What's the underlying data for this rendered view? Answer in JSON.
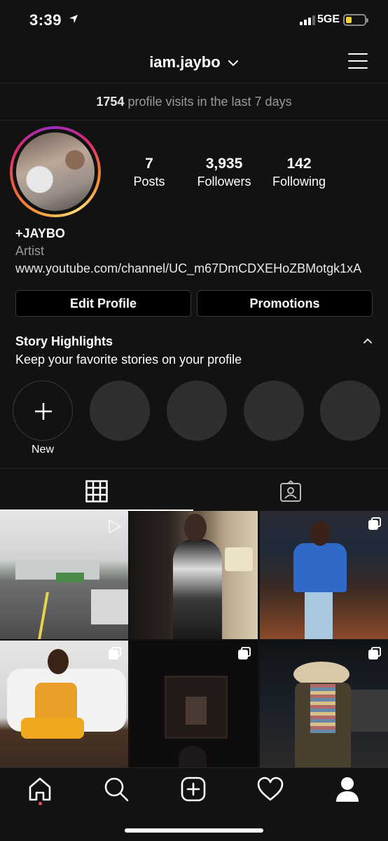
{
  "status_bar": {
    "time": "3:39",
    "network": "5GE",
    "battery_color": "#f4d03f"
  },
  "header": {
    "username": "iam.jaybo",
    "icons": [
      "chevron-down-icon",
      "hamburger-menu-icon"
    ]
  },
  "visits_banner": {
    "count": "1754",
    "text": "profile visits in the last 7 days"
  },
  "profile": {
    "stats": [
      {
        "value": "7",
        "label": "Posts"
      },
      {
        "value": "3,935",
        "label": "Followers"
      },
      {
        "value": "142",
        "label": "Following"
      }
    ],
    "display_name": "+JAYBO",
    "category": "Artist",
    "website": "www.youtube.com/channel/UC_m67DmCDXEHoZBMotgk1xA"
  },
  "buttons": {
    "edit_profile": "Edit Profile",
    "promotions": "Promotions"
  },
  "story_highlights": {
    "title": "Story Highlights",
    "subtitle": "Keep your favorite stories on your profile",
    "new_label": "New"
  },
  "tabs": [
    {
      "name": "grid-icon",
      "active": true
    },
    {
      "name": "tagged-icon",
      "active": false
    }
  ],
  "posts": [
    {
      "kind": "video",
      "palette": [
        "#d9d9db",
        "#8a8c8e",
        "#4a4a4a"
      ]
    },
    {
      "kind": "photo",
      "palette": [
        "#2a2220",
        "#b8a98c",
        "#d8d6d4"
      ]
    },
    {
      "kind": "carousel",
      "palette": [
        "#1e2a3a",
        "#2f6ac9",
        "#3a2018"
      ]
    },
    {
      "kind": "carousel",
      "palette": [
        "#e8e6e4",
        "#e8a028",
        "#3a2a20"
      ]
    },
    {
      "kind": "carousel",
      "palette": [
        "#0e0c0c",
        "#3a2a24",
        "#1a1414"
      ]
    },
    {
      "kind": "carousel",
      "palette": [
        "#101418",
        "#4a4030",
        "#b06868"
      ]
    }
  ],
  "bottom_nav": [
    "home-icon",
    "search-icon",
    "new-post-icon",
    "activity-heart-icon",
    "profile-icon"
  ],
  "colors": {
    "background": "#121212",
    "secondary_text": "#9a9a9a",
    "notification_dot": "#ed4956"
  }
}
